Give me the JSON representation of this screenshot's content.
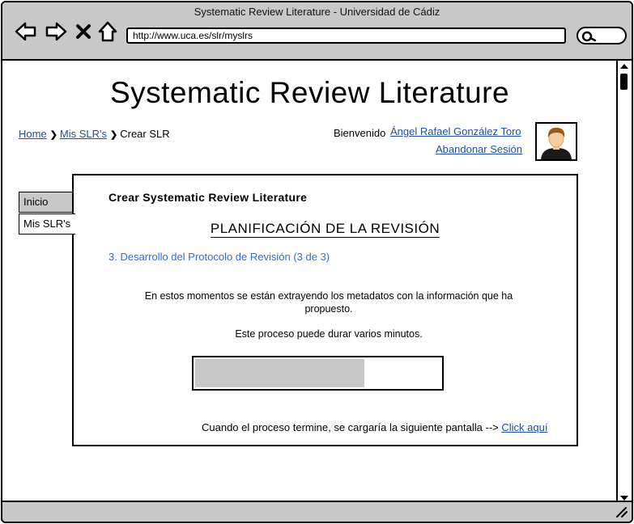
{
  "window": {
    "title": "Systematic Review Literature - Universidad de Cádiz"
  },
  "browser": {
    "url": "http://www.uca.es/slr/myslrs",
    "nav_icons": [
      "back-arrow-icon",
      "forward-arrow-icon",
      "close-x-icon",
      "home-icon"
    ],
    "search_icon": "magnifier-icon"
  },
  "header": {
    "title": "Systematic Review Literature",
    "welcome": "Bienvenido",
    "user_name": "Ángel Rafael González Toro",
    "logout": "Abandonar Sesión"
  },
  "breadcrumb": {
    "items": [
      {
        "label": "Home",
        "link": true
      },
      {
        "label": "Mis SLR's",
        "link": true
      },
      {
        "label": "Crear SLR",
        "link": false
      }
    ]
  },
  "tabs": [
    {
      "label": "Inicio",
      "active": false
    },
    {
      "label": "Mis SLR's",
      "active": true
    }
  ],
  "panel": {
    "title": "Crear Systematic Review Literature",
    "section": "PLANIFICACIÓN DE LA REVISIÓN",
    "step": "3. Desarrollo del Protocolo de Revisión (3 de 3)",
    "message1": "En estos momentos se están extrayendo los metadatos con la información que ha propuesto.",
    "message2": "Este proceso puede durar varios minutos.",
    "progress": 0.69,
    "finish_text": "Cuando el proceso termine, se cargaría la siguiente pantalla -->",
    "finish_link": "Click aquí"
  },
  "colors": {
    "chrome": "#c8c8c8",
    "link": "#1f4e9c",
    "step": "#2b6fd1",
    "progress_fill": "#c8c8c8"
  }
}
